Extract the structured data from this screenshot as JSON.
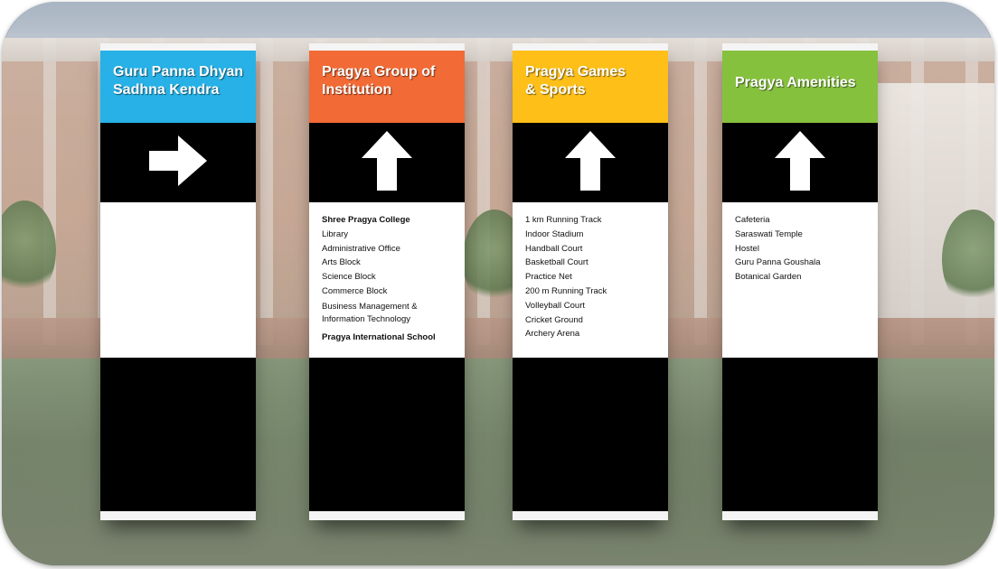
{
  "signs": [
    {
      "title": "Guru Panna Dhyan Sadhna Kendra",
      "title_lines": [
        "Guru Panna Dhyan",
        "Sadhna Kendra"
      ],
      "color": "#27b1e6",
      "arrow": "arrow-right-icon",
      "items": []
    },
    {
      "title": "Pragya Group of Institution",
      "title_lines": [
        "Pragya Group of",
        "Institution"
      ],
      "color": "#f26a35",
      "arrow": "arrow-up-icon",
      "items": [
        "Shree Pragya College",
        "Library",
        "Administrative Office",
        "Arts Block",
        "Science Block",
        "Commerce Block",
        "Business Management &",
        "Information Technology",
        "Pragya International School"
      ]
    },
    {
      "title": "Pragya Games & Sports",
      "title_lines": [
        "Pragya Games",
        "& Sports"
      ],
      "color": "#fdbf18",
      "arrow": "arrow-up-icon",
      "items": [
        "1 km Running Track",
        "Indoor Stadium",
        "Handball Court",
        "Basketball Court",
        "Practice Net",
        "200 m Running Track",
        "Volleyball Court",
        "Cricket Ground",
        "Archery Arena"
      ]
    },
    {
      "title": "Pragya Amenities",
      "title_lines": [
        "Pragya Amenities"
      ],
      "color": "#86c13e",
      "arrow": "arrow-up-icon",
      "items": [
        "Cafeteria",
        "Saraswati Temple",
        "Hostel",
        "Guru Panna Goushala",
        "Botanical Garden"
      ]
    }
  ]
}
